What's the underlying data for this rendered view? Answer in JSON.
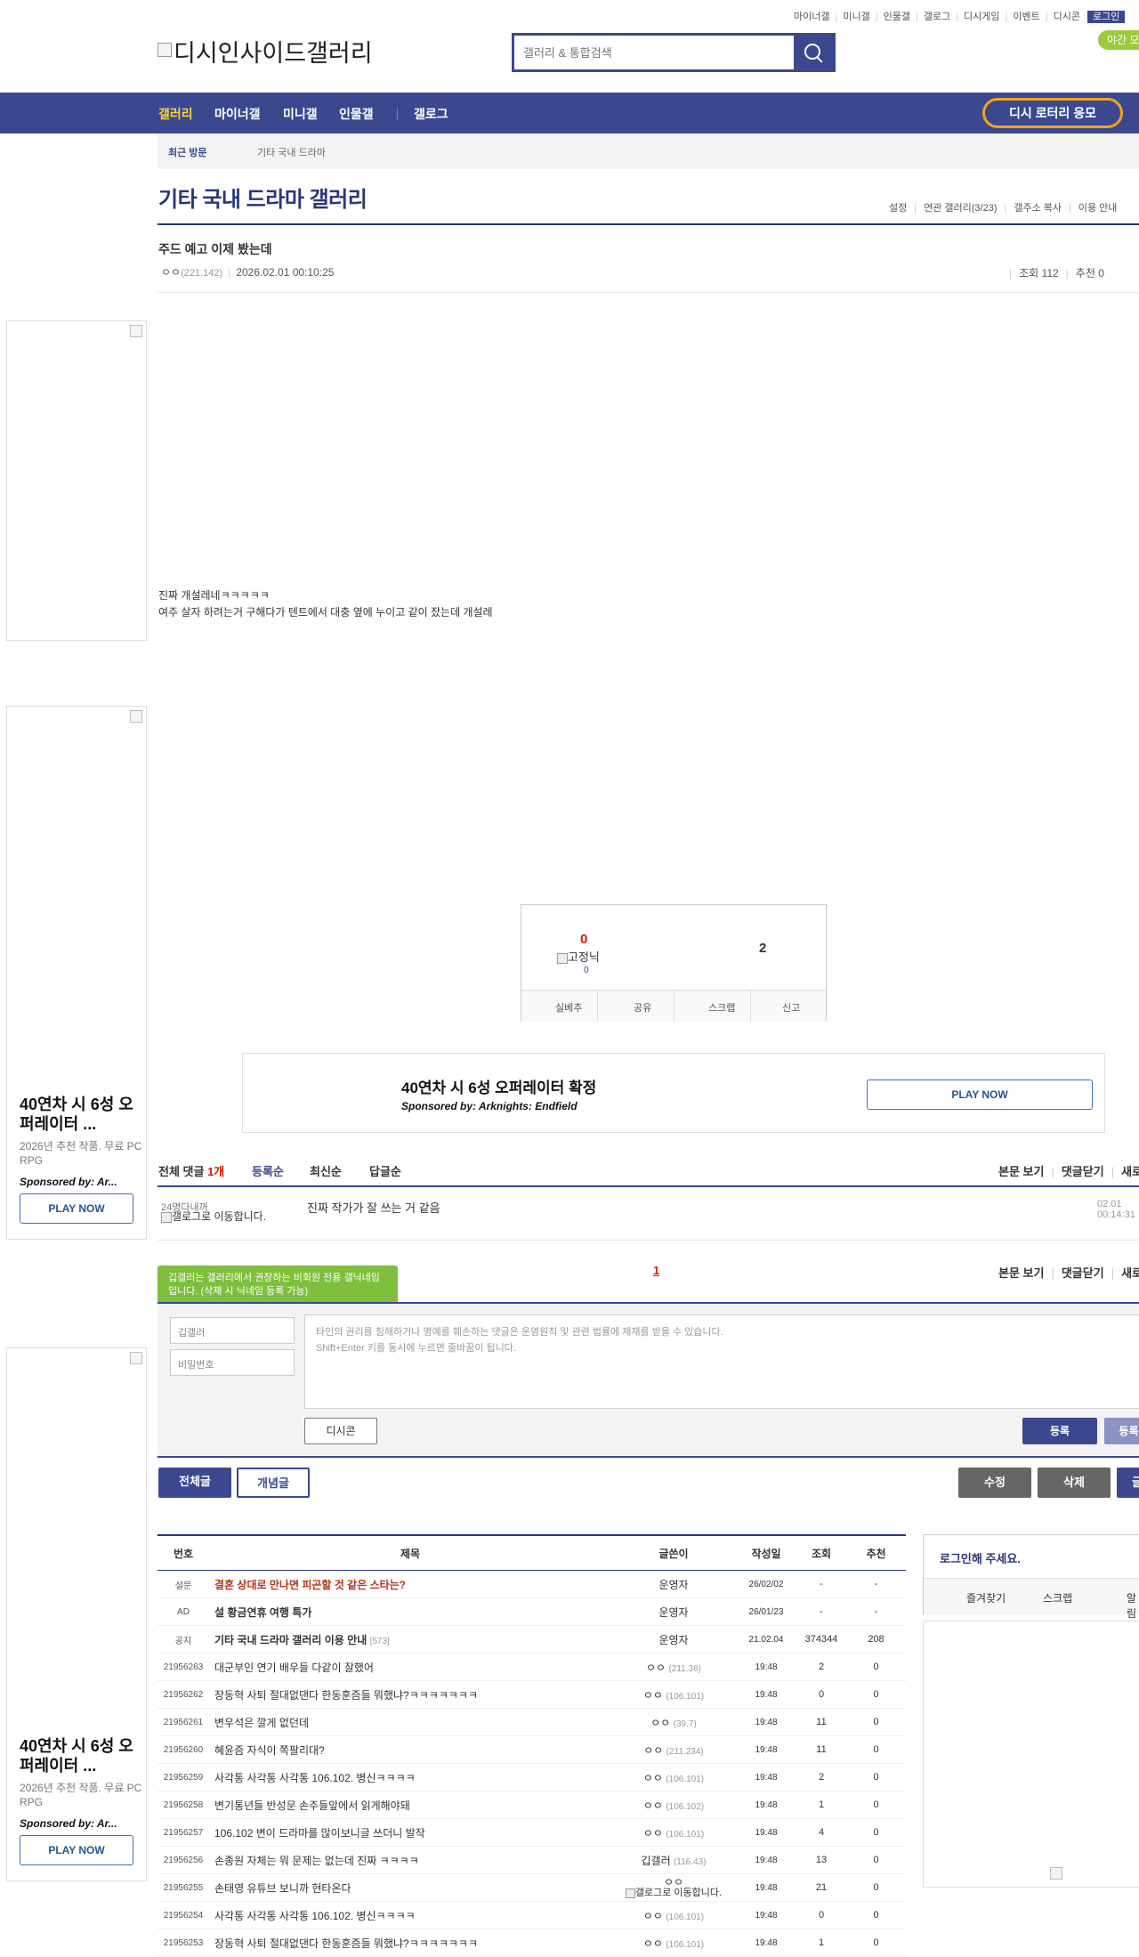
{
  "toplinks": [
    "마이너갤",
    "미니갤",
    "인물갤",
    "갤로그",
    "디시게임",
    "이벤트",
    "디시콘"
  ],
  "login_label": "로그인",
  "night_label": "야간 모드",
  "logo_alt": "디시인사이드갤러리",
  "search": {
    "placeholder": "갤러리 & 통합검색"
  },
  "gnb": {
    "items": [
      "갤러리",
      "마이너갤",
      "미니갤",
      "인물갤",
      "갤로그"
    ],
    "lottery": "디시 로터리 응모"
  },
  "recent": {
    "label": "최근 방문",
    "item": "기타 국내 드라마"
  },
  "gallery": {
    "title": "기타 국내 드라마 갤러리",
    "menu": [
      "설정",
      "연관 갤러리(3/23)",
      "갤주소 복사",
      "이용 안내"
    ]
  },
  "post": {
    "title": "주드 예고 이제 봤는데",
    "writer": "ㅇㅇ",
    "ip": "(221.142)",
    "datetime": "2026.02.01 00:10:25",
    "views": "조회 112",
    "recommend": "추천 0",
    "body_lines": [
      "진짜 개설레네ㅋㅋㅋㅋㅋ",
      "여주 살자 하려는거 구해다가 텐트에서 대충 옆에 누이고 같이 잤는데 개설레"
    ],
    "up_count": "0",
    "gallery_image_alt": "고정닉",
    "fixed_count": "0",
    "down_count": "2",
    "actions": [
      "실베추",
      "공유",
      "스크랩",
      "신고"
    ]
  },
  "ads": {
    "title": "40연차 시 6성 오퍼레이터 확정",
    "title_short": "40연차 시 6성 오퍼레이터 ...",
    "sub": "2026년 추천 작품. 무료 PC RPG",
    "sponsor": "Sponsored by: Arknights: Endfield",
    "sponsor_short": "Sponsored by: Ar...",
    "play": "PLAY NOW"
  },
  "comments": {
    "header": "전체 댓글",
    "count": "1개",
    "sorts": [
      "등록순",
      "최신순",
      "답글순"
    ],
    "options": [
      "본문 보기",
      "댓글닫기",
      "새로고침"
    ],
    "items": [
      {
        "nick": "24명다내꺼",
        "gallog": "갤로그로 이동합니다.",
        "text": "진짜 작가가 잘 쓰는 거 같음",
        "date": "02.01 00:14:31"
      }
    ],
    "page": "1"
  },
  "write": {
    "tooltip": "깁갤러는 갤러리에서 권장하는 비회원 전용 갤닉네임입니다. (삭제 시 닉네임 등록 가능)",
    "nick_value": "깁갤러",
    "password_placeholder": "비밀번호",
    "notice_line1": "타인의 권리를 침해하거나 명예를 훼손하는 댓글은 운영원칙 및 관련 법률에 제재를 받을 수 있습니다.",
    "notice_line2": "Shift+Enter 키를 동시에 누르면 줄바꿈이 됩니다.",
    "dccon": "디시콘",
    "submit": "등록",
    "submit_recommend": "등록+추천"
  },
  "list_tabs": [
    "전체글",
    "개념글"
  ],
  "post_actions": [
    "수정",
    "삭제",
    "글쓰기"
  ],
  "list": {
    "headers": [
      "번호",
      "제목",
      "글쓴이",
      "작성일",
      "조회",
      "추천"
    ],
    "rows": [
      {
        "type": "survey",
        "num": "설문",
        "subject": "결혼 상대로 만나면 피곤할 것 같은 스타는?",
        "writer": "운영자",
        "ip": "",
        "date": "26/02/02",
        "views": "-",
        "rec": "-"
      },
      {
        "type": "notice",
        "num": "AD",
        "subject": "설 황금연휴 여행 특가",
        "writer": "운영자",
        "ip": "",
        "date": "26/01/23",
        "views": "-",
        "rec": "-"
      },
      {
        "type": "notice",
        "num": "공지",
        "subject": "기타 국내 드라마 갤러리 이용 안내",
        "rc": "[573]",
        "writer": "운영자",
        "ip": "",
        "date": "21.02.04",
        "views": "374344",
        "rec": "208"
      },
      {
        "type": "normal",
        "num": "21956263",
        "subject": "대군부인 연기 배우들 다같이 잘했어",
        "writer": "ㅇㅇ",
        "ip": "(211.36)",
        "date": "19:48",
        "views": "2",
        "rec": "0"
      },
      {
        "type": "normal",
        "num": "21956262",
        "subject": "장동혁 사퇴 절대없댄다 한동훈즘들 뭐했냐?ㅋㅋㅋㅋㅋㅋㅋ",
        "writer": "ㅇㅇ",
        "ip": "(106.101)",
        "date": "19:48",
        "views": "0",
        "rec": "0"
      },
      {
        "type": "normal",
        "num": "21956261",
        "subject": "변우석은 깔게 없던데",
        "writer": "ㅇㅇ",
        "ip": "(39.7)",
        "date": "19:48",
        "views": "11",
        "rec": "0"
      },
      {
        "type": "normal",
        "num": "21956260",
        "subject": "혜윤즘 자식이 쪽팔리대?",
        "writer": "ㅇㅇ",
        "ip": "(211.234)",
        "date": "19:48",
        "views": "11",
        "rec": "0"
      },
      {
        "type": "normal",
        "num": "21956259",
        "subject": "사각통 사각통 사각통 106.102. 병신ㅋㅋㅋㅋ",
        "writer": "ㅇㅇ",
        "ip": "(106.101)",
        "date": "19:48",
        "views": "2",
        "rec": "0"
      },
      {
        "type": "normal",
        "num": "21956258",
        "subject": "변기통년들 반성문 손주들앞에서 읽게해야돼",
        "writer": "ㅇㅇ",
        "ip": "(106.102)",
        "date": "19:48",
        "views": "1",
        "rec": "0"
      },
      {
        "type": "normal",
        "num": "21956257",
        "subject": "106.102 변이 드라마를 많이보니글 쓰더니 발작",
        "writer": "ㅇㅇ",
        "ip": "(106.101)",
        "date": "19:48",
        "views": "4",
        "rec": "0"
      },
      {
        "type": "normal",
        "num": "21956256",
        "subject": "손종원 자체는 뭐 문제는 없는데 진짜 ㅋㅋㅋㅋ",
        "writer": "깁갤러",
        "ip": "(116.43)",
        "date": "19:48",
        "views": "13",
        "rec": "0"
      },
      {
        "type": "gallog",
        "num": "21956255",
        "subject": "손태영 유튜브 보니까 현타온다",
        "writer": "ㅇㅇ",
        "gallog": "갤로그로 이동합니다.",
        "ip": "",
        "date": "19:48",
        "views": "21",
        "rec": "0"
      },
      {
        "type": "normal",
        "num": "21956254",
        "subject": "사각통 사각통 사각통 106.102. 병신ㅋㅋㅋㅋ",
        "writer": "ㅇㅇ",
        "ip": "(106.101)",
        "date": "19:48",
        "views": "0",
        "rec": "0"
      },
      {
        "type": "normal",
        "num": "21956253",
        "subject": "장동혁 사퇴 절대없댄다 한동훈즘들 뭐했냐?ㅋㅋㅋㅋㅋㅋㅋ",
        "writer": "ㅇㅇ",
        "ip": "(106.101)",
        "date": "19:48",
        "views": "1",
        "rec": "0"
      }
    ]
  },
  "sidebar": {
    "login_prompt": "로그인해 주세요.",
    "links": [
      "즐겨찾기",
      "스크랩",
      "알림"
    ]
  },
  "colors": {
    "primary": "#3b4890",
    "title": "#29367c",
    "accent": "#d31900",
    "lottery_border": "#f7a21b",
    "night": "#9ccb3b"
  }
}
